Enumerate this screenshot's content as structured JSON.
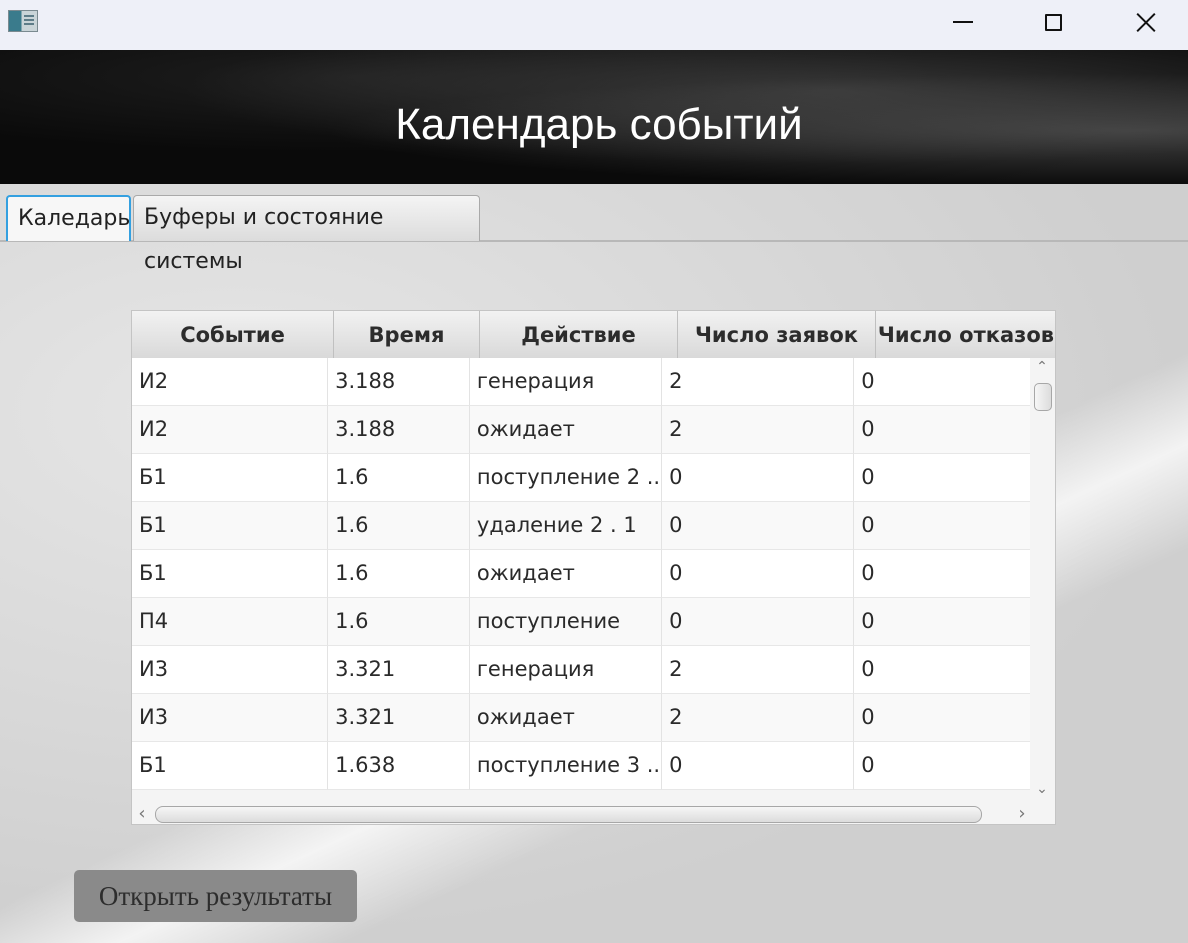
{
  "window": {
    "app_icon": "app-window-icon",
    "controls": [
      "minimize-icon",
      "maximize-icon",
      "close-icon"
    ]
  },
  "header": {
    "title": "Календарь событий"
  },
  "tabs": [
    {
      "label": "Каледарь",
      "active": true
    },
    {
      "label": "Буферы и состояние системы",
      "active": false
    }
  ],
  "table": {
    "columns": [
      "Событие",
      "Время",
      "Действие",
      "Число заявок",
      "Число отказов"
    ],
    "rows": [
      [
        "И2",
        "3.188",
        "генерация",
        "2",
        "0"
      ],
      [
        "И2",
        "3.188",
        "ожидает",
        "2",
        "0"
      ],
      [
        "Б1",
        "1.6",
        "поступление 2 ...",
        "0",
        "0"
      ],
      [
        "Б1",
        "1.6",
        "удаление 2 . 1",
        "0",
        "0"
      ],
      [
        "Б1",
        "1.6",
        "ожидает",
        "0",
        "0"
      ],
      [
        "П4",
        "1.6",
        "поступление",
        "0",
        "0"
      ],
      [
        "И3",
        "3.321",
        "генерация",
        "2",
        "0"
      ],
      [
        "И3",
        "3.321",
        "ожидает",
        "2",
        "0"
      ],
      [
        "Б1",
        "1.638",
        "поступление 3 ...",
        "0",
        "0"
      ]
    ]
  },
  "actions": {
    "open_results": "Открыть результаты"
  }
}
